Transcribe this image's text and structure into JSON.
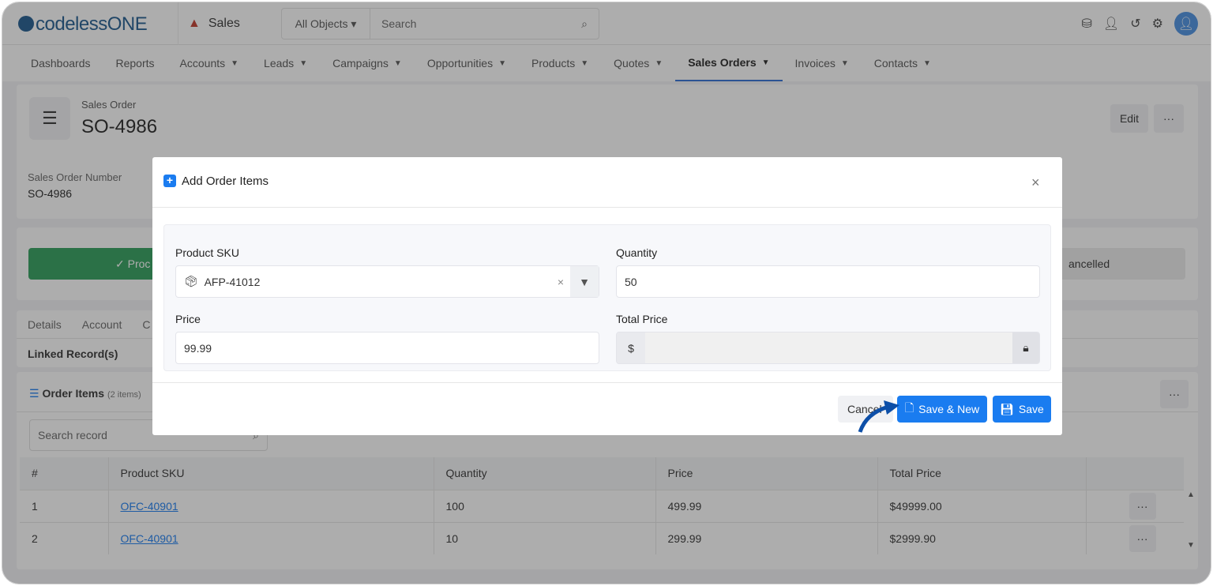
{
  "header": {
    "logo": "codelessONE",
    "app": "Sales",
    "object_select": "All Objects",
    "search_placeholder": "Search"
  },
  "nav": [
    "Dashboards",
    "Reports",
    "Accounts",
    "Leads",
    "Campaigns",
    "Opportunities",
    "Products",
    "Quotes",
    "Sales Orders",
    "Invoices",
    "Contacts"
  ],
  "nav_dropdowns": [
    false,
    false,
    true,
    true,
    true,
    true,
    true,
    true,
    true,
    true,
    true
  ],
  "nav_active": "Sales Orders",
  "record": {
    "type": "Sales Order",
    "title": "SO-4986",
    "edit": "Edit",
    "more": "···",
    "field_label": "Sales Order Number",
    "field_value": "SO-4986"
  },
  "status": {
    "processing_partial": "Proc",
    "cancelled_partial": "ancelled"
  },
  "tabs": [
    "Details",
    "Account",
    "C"
  ],
  "linked": "Linked Record(s)",
  "order_items": {
    "title": "Order Items",
    "count": "(2 items)",
    "search_placeholder": "Search record",
    "columns": [
      "#",
      "Product SKU",
      "Quantity",
      "Price",
      "Total Price"
    ],
    "rows": [
      [
        "1",
        "OFC-40901",
        "100",
        "499.99",
        "$49999.00"
      ],
      [
        "2",
        "OFC-40901",
        "10",
        "299.99",
        "$2999.90"
      ]
    ]
  },
  "modal": {
    "title": "Add Order Items",
    "sku_label": "Product SKU",
    "sku_value": "AFP-41012",
    "qty_label": "Quantity",
    "qty_value": "50",
    "price_label": "Price",
    "price_value": "99.99",
    "total_label": "Total Price",
    "currency": "$",
    "cancel": "Cancel",
    "save_new": "Save & New",
    "save": "Save"
  },
  "colors": {
    "primary": "#1a7cf0",
    "success": "#2e9e5b",
    "brand": "#1d5a8f",
    "annotation_arrow": "#0d4fa8"
  }
}
